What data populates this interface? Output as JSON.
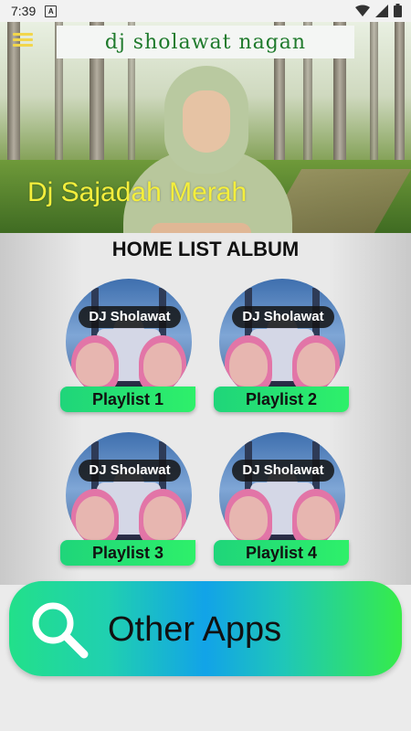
{
  "status_bar": {
    "time": "7:39",
    "notification_badge": "A"
  },
  "header": {
    "logo_text": "dj sholawat nagan",
    "hero_title": "Dj Sajadah Merah",
    "menu_icon": "hamburger-menu-icon"
  },
  "section": {
    "title": "HOME LIST ALBUM"
  },
  "albums": [
    {
      "cover_text": "DJ Sholawat",
      "label": "Playlist 1"
    },
    {
      "cover_text": "DJ Sholawat",
      "label": "Playlist 2"
    },
    {
      "cover_text": "DJ Sholawat",
      "label": "Playlist 3"
    },
    {
      "cover_text": "DJ Sholawat",
      "label": "Playlist 4"
    }
  ],
  "other_apps": {
    "label": "Other Apps",
    "icon": "search-icon"
  },
  "colors": {
    "hero_title": "#f4ee3c",
    "menu_icon": "#f2d64b",
    "logo_text": "#1f7a2c",
    "playlist_pill": "#2ef06a",
    "other_apps_center": "#12a3e8"
  }
}
